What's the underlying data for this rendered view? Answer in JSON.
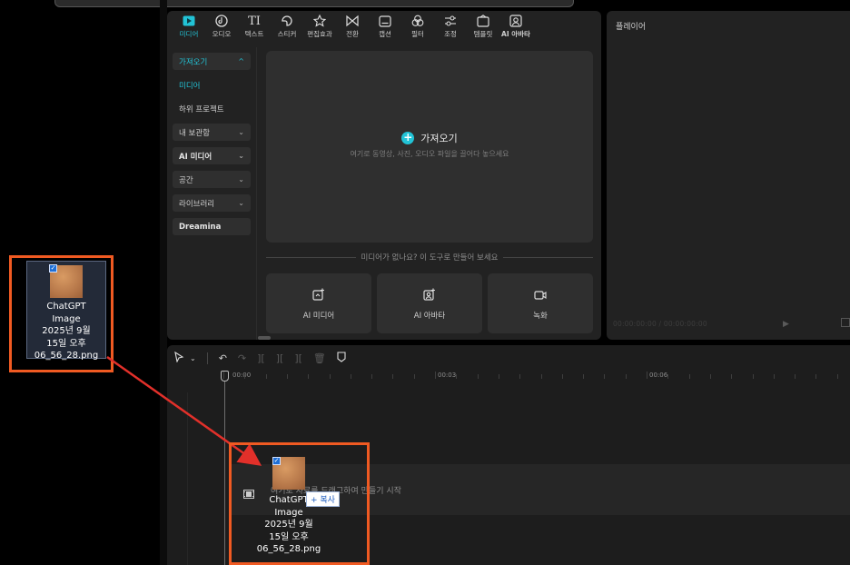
{
  "toolbar": {
    "tabs": [
      {
        "label": "미디어",
        "icon": "media-icon",
        "active": true
      },
      {
        "label": "오디오",
        "icon": "audio-icon"
      },
      {
        "label": "텍스트",
        "icon": "text-icon",
        "glyph": "TI"
      },
      {
        "label": "스티커",
        "icon": "sticker-icon"
      },
      {
        "label": "편집효과",
        "icon": "effects-icon"
      },
      {
        "label": "전환",
        "icon": "transition-icon"
      },
      {
        "label": "캡션",
        "icon": "caption-icon"
      },
      {
        "label": "필터",
        "icon": "filter-icon"
      },
      {
        "label": "조정",
        "icon": "adjust-icon"
      },
      {
        "label": "템플릿",
        "icon": "template-icon"
      },
      {
        "label": "AI 아바타",
        "icon": "ai-avatar-icon"
      }
    ]
  },
  "sidebar": {
    "items": [
      {
        "label": "가져오기",
        "chevron": "^"
      },
      {
        "label": "미디어"
      },
      {
        "label": "하위 프로젝트"
      },
      {
        "label": "내 보관함",
        "chevron": "⌄"
      },
      {
        "label": "AI 미디어",
        "chevron": "⌄"
      },
      {
        "label": "공간",
        "chevron": "⌄"
      },
      {
        "label": "라이브러리",
        "chevron": "⌄"
      },
      {
        "label": "Dreamina"
      }
    ]
  },
  "import": {
    "label": "가져오기",
    "hint": "여기로 동영상, 사진, 오디오 파일을 끌어다 놓으세요"
  },
  "no_media": {
    "text": "미디어가 없나요? 이 도구로 만들어 보세요"
  },
  "tiles": [
    {
      "label": "AI 미디어",
      "icon": "ai-media-icon"
    },
    {
      "label": "AI 아바타",
      "icon": "ai-avatar-icon"
    },
    {
      "label": "녹화",
      "icon": "record-icon"
    }
  ],
  "player": {
    "title": "플레이어",
    "time": "00:00:00:00 / 00:00:00:00"
  },
  "timeline": {
    "ruler": [
      "00:00",
      "00:03",
      "00:06"
    ],
    "drag_hint": "여기로 자료를 드래그하여 만들기 시작"
  },
  "desktop_file": {
    "name_lines": [
      "ChatGPT",
      "Image",
      "2025년 9월",
      "15일 오후",
      "06_56_28.png"
    ]
  },
  "drag": {
    "name_lines": [
      "ChatGPT",
      "Image",
      "2025년 9월",
      "15일 오후",
      "06_56_28.png"
    ],
    "copy_badge": "+ 복사"
  },
  "colors": {
    "accent": "#22c3d6",
    "highlight": "#f05a22",
    "panel": "#222222"
  }
}
